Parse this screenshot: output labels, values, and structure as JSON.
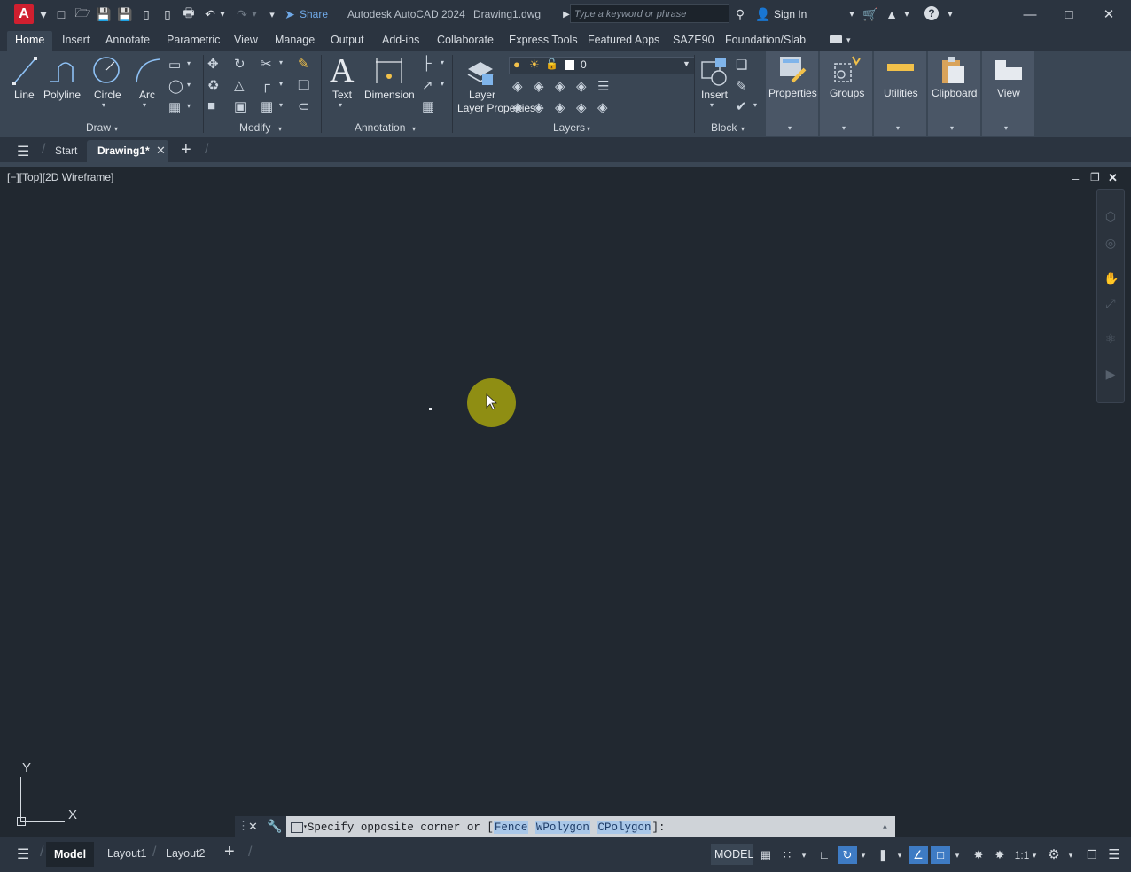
{
  "title": {
    "app_name": "Autodesk AutoCAD 2024",
    "document": "Drawing1.dwg",
    "share_label": "Share",
    "search_placeholder": "Type a keyword or phrase",
    "signin_label": "Sign In",
    "logo_letter": "A"
  },
  "ribbon_tabs": [
    "Home",
    "Insert",
    "Annotate",
    "Parametric",
    "View",
    "Manage",
    "Output",
    "Add-ins",
    "Collaborate",
    "Express Tools",
    "Featured Apps",
    "SAZE90",
    "Foundation/Slab"
  ],
  "ribbon": {
    "draw": {
      "title": "Draw",
      "tools": [
        "Line",
        "Polyline",
        "Circle",
        "Arc"
      ]
    },
    "modify": {
      "title": "Modify"
    },
    "annotation": {
      "title": "Annotation",
      "tools": [
        "Text",
        "Dimension"
      ]
    },
    "layers": {
      "title": "Layers",
      "layer_properties": "Layer Properties",
      "current_layer": "0"
    },
    "block": {
      "title": "Block",
      "insert": "Insert"
    },
    "big": [
      "Properties",
      "Groups",
      "Utilities",
      "Clipboard",
      "View"
    ]
  },
  "file_tabs": {
    "start": "Start",
    "active": "Drawing1*"
  },
  "viewport": {
    "controls": "[−][Top][2D Wireframe]"
  },
  "ucs": {
    "x": "X",
    "y": "Y"
  },
  "command": {
    "prompt_prefix": "Specify opposite corner or [",
    "options": [
      "Fence",
      "WPolygon",
      "CPolygon"
    ],
    "prompt_suffix": "]:"
  },
  "status": {
    "tabs": [
      "Model",
      "Layout1",
      "Layout2"
    ],
    "model_label": "MODEL",
    "scale": "1:1"
  },
  "colors": {
    "accent": "#3e7bc4",
    "logo": "#d01f2f",
    "cursor_highlight": "#8f8e13"
  }
}
